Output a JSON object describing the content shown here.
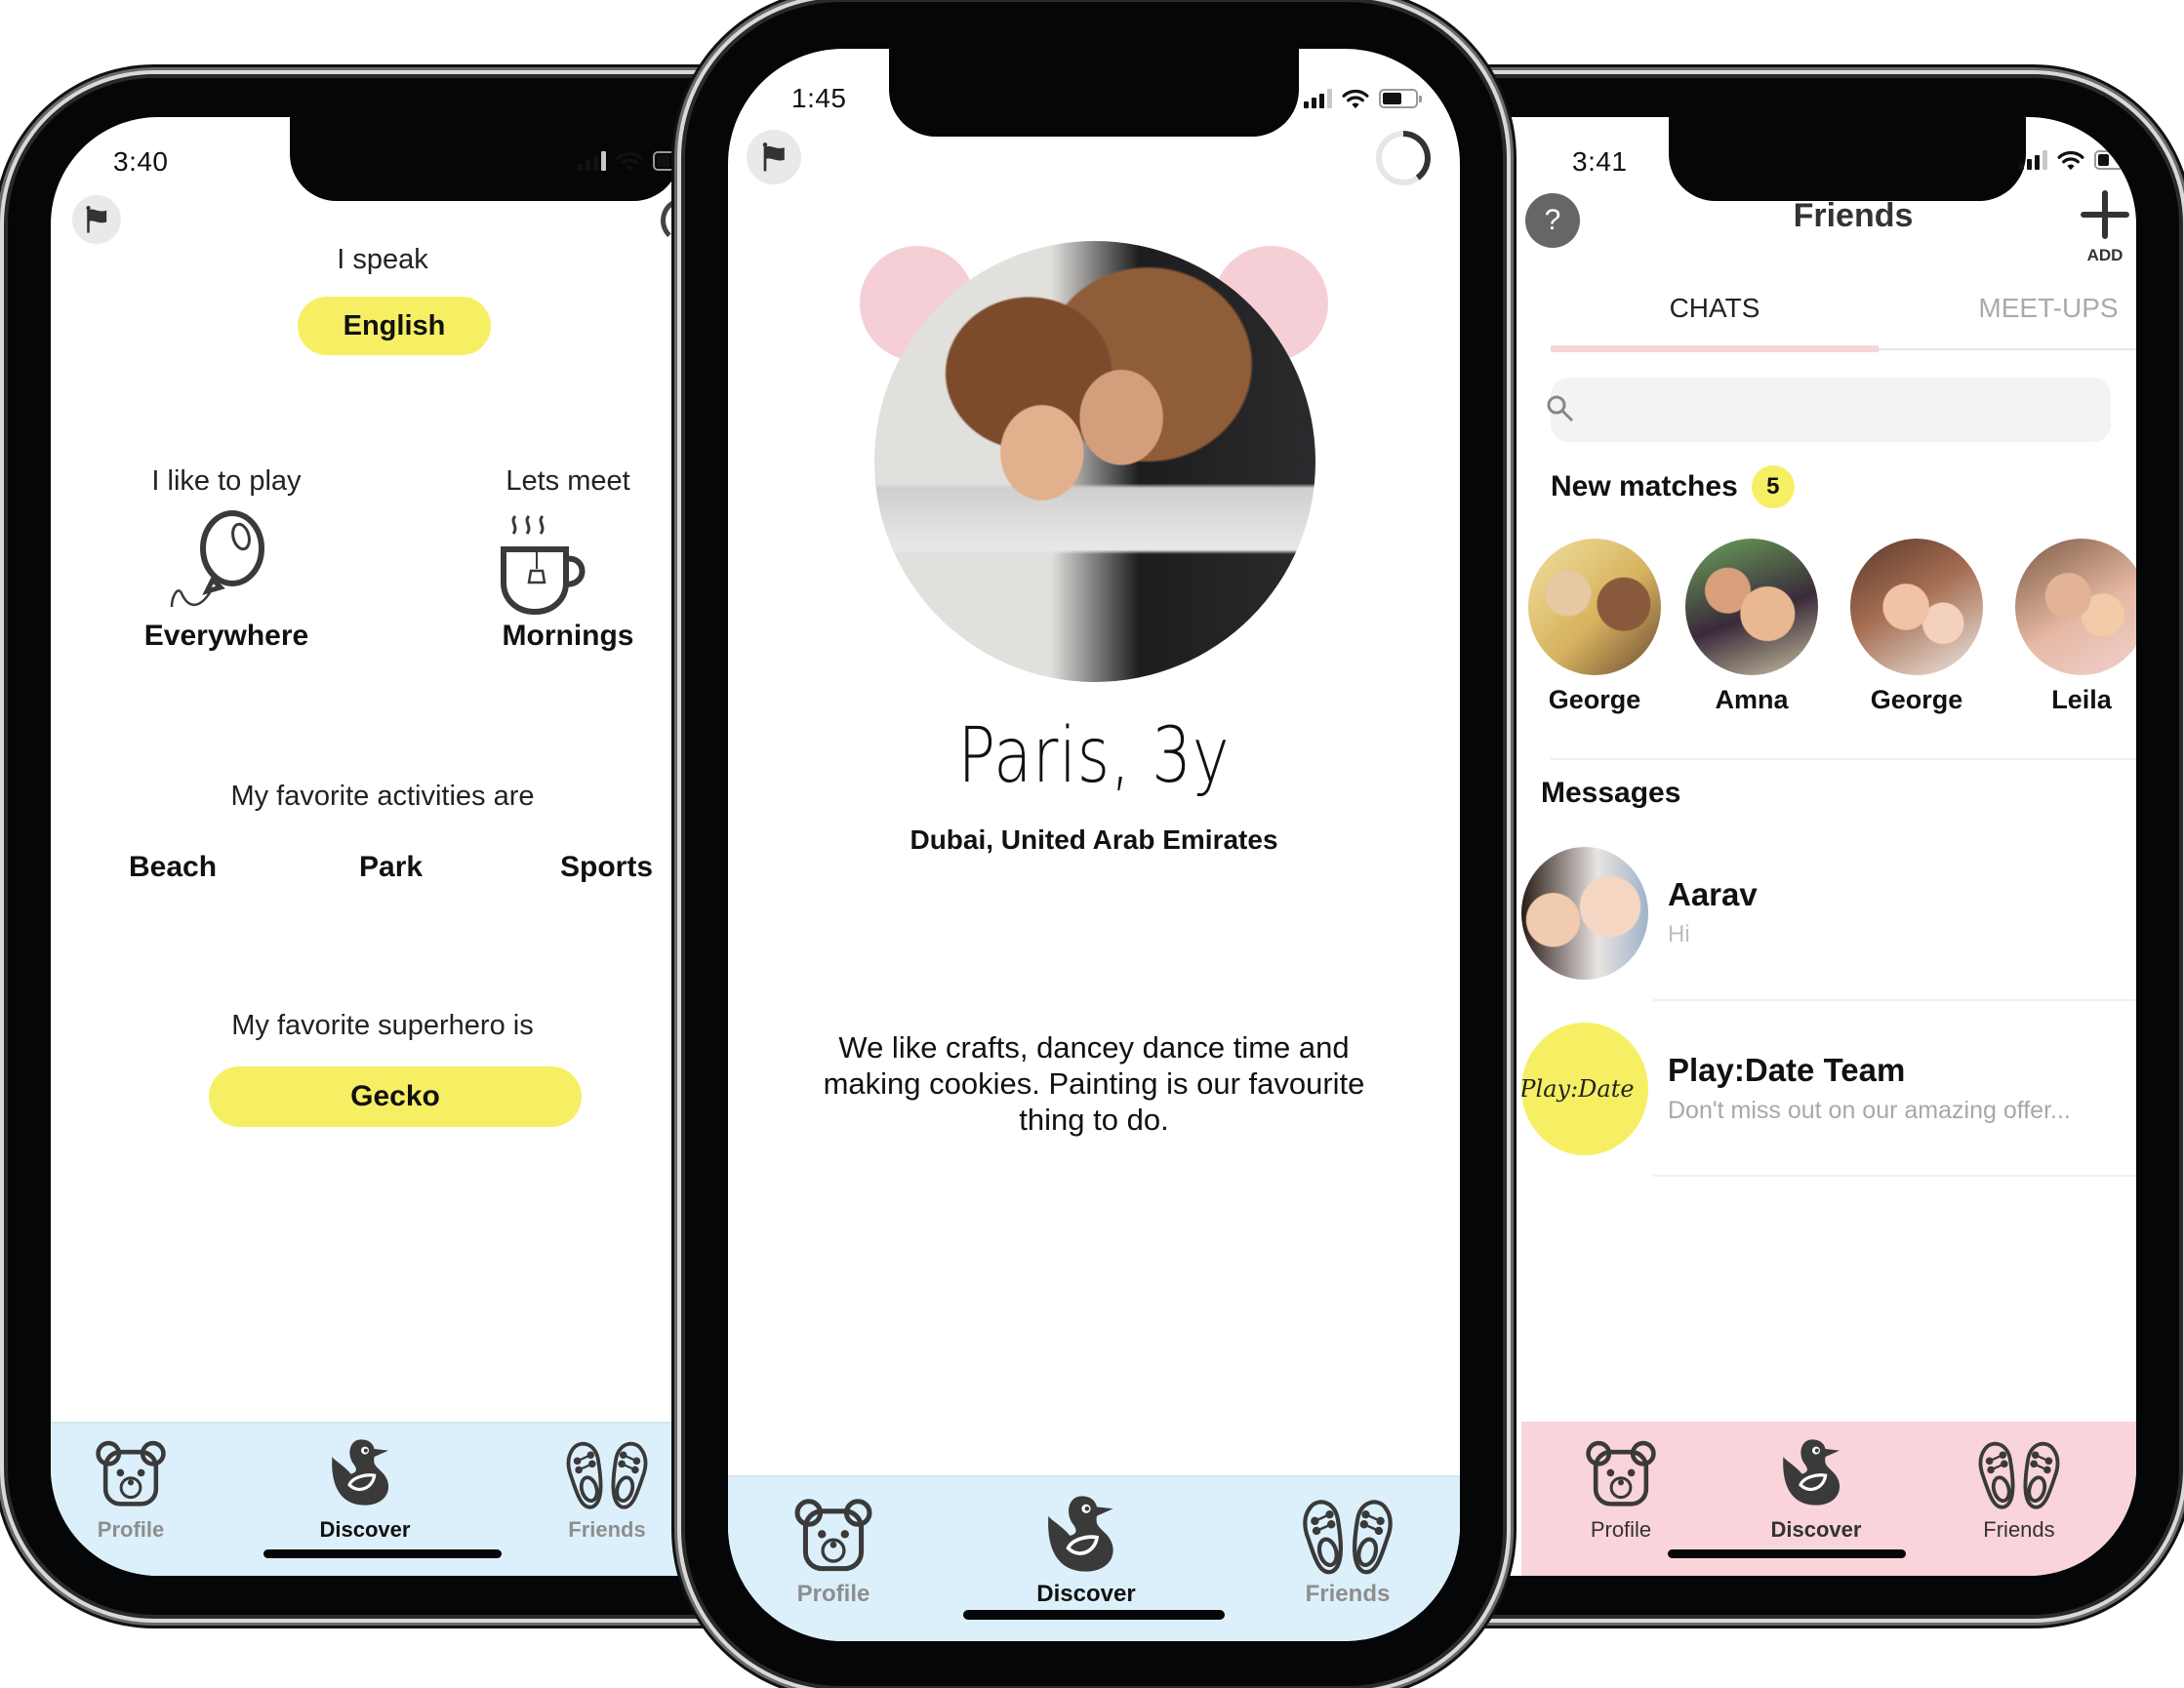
{
  "colors": {
    "yellow_accent": "#f7ef63",
    "tabbar_blue": "#dcf0fb",
    "tabbar_pink": "#f9d4da",
    "bear_ear_pink": "#f6cfd6",
    "inactive_gray": "#8e8e8e",
    "tab_underline_pink": "#f9d4da"
  },
  "phones": {
    "left": {
      "status": {
        "time": "3:40"
      },
      "screen": "profile-details",
      "flag_button_icon": "flag-icon",
      "speak": {
        "label": "I speak",
        "value": "English"
      },
      "play": {
        "label": "I like to play",
        "value": "Everywhere",
        "icon": "balloon-icon"
      },
      "meet": {
        "label": "Lets meet",
        "value": "Mornings",
        "icon": "tea-cup-icon"
      },
      "activities": {
        "label": "My favorite activities are",
        "items": [
          "Beach",
          "Park",
          "Sports"
        ]
      },
      "superhero": {
        "label": "My favorite superhero is",
        "value": "Gecko"
      },
      "tabbar": {
        "style": "blue",
        "tabs": [
          {
            "label": "Profile",
            "icon": "teddy-bear-icon",
            "active": false
          },
          {
            "label": "Discover",
            "icon": "rubber-duck-icon",
            "active": true
          },
          {
            "label": "Friends",
            "icon": "baby-shoes-icon",
            "active": false
          }
        ]
      }
    },
    "center": {
      "status": {
        "time": "1:45"
      },
      "screen": "discover",
      "flag_button_icon": "flag-icon",
      "progress_ring": {
        "icon": "progress-ring-icon",
        "fraction": 0.4
      },
      "profile": {
        "name_age": "Paris, 3y",
        "location": "Dubai, United Arab Emirates",
        "bio": "We like crafts, dancey dance time and making cookies. Painting is our favourite thing to do.",
        "photo_alt": "Mother and child with curly hair hugging"
      },
      "tabbar": {
        "style": "blue",
        "tabs": [
          {
            "label": "Profile",
            "icon": "teddy-bear-icon",
            "active": false
          },
          {
            "label": "Discover",
            "icon": "rubber-duck-icon",
            "active": true
          },
          {
            "label": "Friends",
            "icon": "baby-shoes-icon",
            "active": false
          }
        ]
      }
    },
    "right": {
      "status": {
        "time": "3:41"
      },
      "screen": "friends",
      "header": {
        "title": "Friends",
        "help_icon": "?",
        "add_label": "ADD"
      },
      "segments": [
        {
          "label": "CHATS",
          "active": true
        },
        {
          "label": "MEET-UPS",
          "active": false
        }
      ],
      "search": {
        "placeholder": ""
      },
      "new_matches": {
        "title": "New matches",
        "count": "5",
        "items": [
          {
            "name": "George"
          },
          {
            "name": "Amna"
          },
          {
            "name": "George"
          },
          {
            "name": "Leila"
          }
        ]
      },
      "messages": {
        "title": "Messages",
        "items": [
          {
            "name": "Aarav",
            "preview": "Hi",
            "avatar": "photo"
          },
          {
            "name": "Play:Date Team",
            "preview": "Don't miss out on our amazing offer...",
            "avatar": "brand",
            "avatar_text": "Play:Date"
          }
        ]
      },
      "tabbar": {
        "style": "pink",
        "tabs": [
          {
            "label": "Profile",
            "icon": "teddy-bear-icon",
            "active": false
          },
          {
            "label": "Discover",
            "icon": "rubber-duck-icon",
            "active": true
          },
          {
            "label": "Friends",
            "icon": "baby-shoes-icon",
            "active": false
          }
        ]
      }
    }
  }
}
